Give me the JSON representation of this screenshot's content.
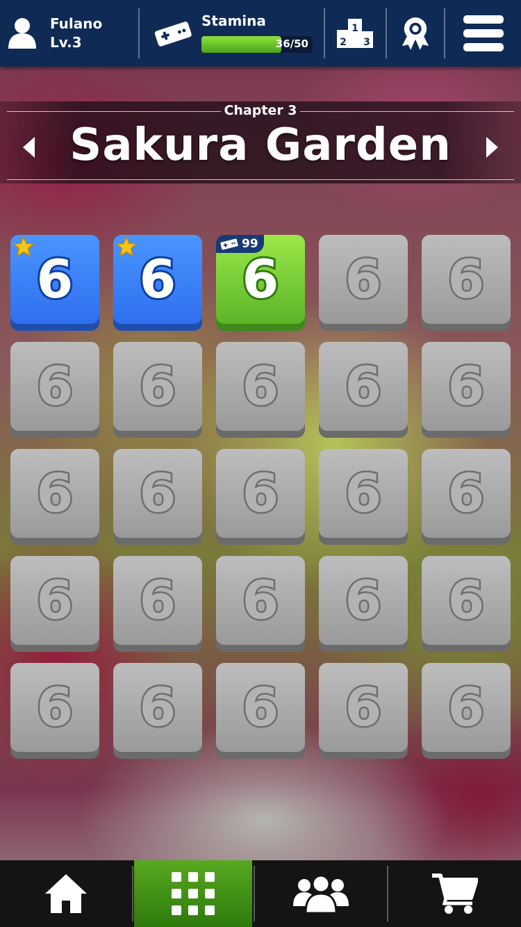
{
  "header": {
    "player": {
      "name": "Fulano",
      "level": "Lv.3"
    },
    "stamina": {
      "label": "Stamina",
      "current": 36,
      "max": 50,
      "text": "36/50",
      "fraction": 0.72
    },
    "buttons": [
      {
        "icon": "podium-icon",
        "ranks": [
          "1",
          "2",
          "3"
        ]
      },
      {
        "icon": "award-ribbon-icon"
      },
      {
        "icon": "hamburger-menu-icon"
      }
    ]
  },
  "chapter": {
    "label": "Chapter 3",
    "name": "Sakura Garden"
  },
  "levels": [
    {
      "number": "6",
      "state": "cleared",
      "stars": 1
    },
    {
      "number": "6",
      "state": "cleared",
      "stars": 1
    },
    {
      "number": "6",
      "state": "current",
      "cost": "99"
    },
    {
      "number": "6",
      "state": "locked"
    },
    {
      "number": "6",
      "state": "locked"
    },
    {
      "number": "6",
      "state": "locked"
    },
    {
      "number": "6",
      "state": "locked"
    },
    {
      "number": "6",
      "state": "locked"
    },
    {
      "number": "6",
      "state": "locked"
    },
    {
      "number": "6",
      "state": "locked"
    },
    {
      "number": "6",
      "state": "locked"
    },
    {
      "number": "6",
      "state": "locked"
    },
    {
      "number": "6",
      "state": "locked"
    },
    {
      "number": "6",
      "state": "locked"
    },
    {
      "number": "6",
      "state": "locked"
    },
    {
      "number": "6",
      "state": "locked"
    },
    {
      "number": "6",
      "state": "locked"
    },
    {
      "number": "6",
      "state": "locked"
    },
    {
      "number": "6",
      "state": "locked"
    },
    {
      "number": "6",
      "state": "locked"
    },
    {
      "number": "6",
      "state": "locked"
    },
    {
      "number": "6",
      "state": "locked"
    },
    {
      "number": "6",
      "state": "locked"
    },
    {
      "number": "6",
      "state": "locked"
    },
    {
      "number": "6",
      "state": "locked"
    }
  ],
  "nav": [
    {
      "icon": "home-icon",
      "active": false
    },
    {
      "icon": "level-grid-icon",
      "active": true
    },
    {
      "icon": "friends-icon",
      "active": false
    },
    {
      "icon": "shopping-cart-icon",
      "active": false
    }
  ],
  "colors": {
    "header_bg": "#0f2a55",
    "stamina_fill": "#6cc42a",
    "cleared_tile": "#3a82f8",
    "current_tile": "#7fd43a",
    "locked_tile": "#aaaaaa",
    "active_nav": "#4a9a18",
    "star": "#f5c518"
  }
}
